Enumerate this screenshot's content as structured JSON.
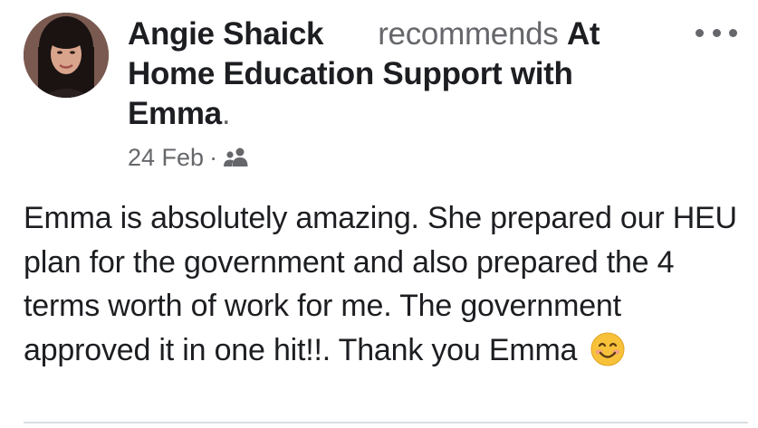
{
  "post": {
    "author": "Angie Shaick",
    "verb": "recommends",
    "page_name": "At Home Education Support with Emma",
    "period": ".",
    "date": "24 Feb",
    "separator": "·",
    "audience_icon": "friends-icon",
    "more_icon": "more-options-icon",
    "body": "Emma is absolutely amazing. She prepared our HEU plan for the government and also prepared the 4 terms worth of work for me. The government approved it in one hit!!. Thank you Emma",
    "emoji": "smiling-face-icon"
  }
}
